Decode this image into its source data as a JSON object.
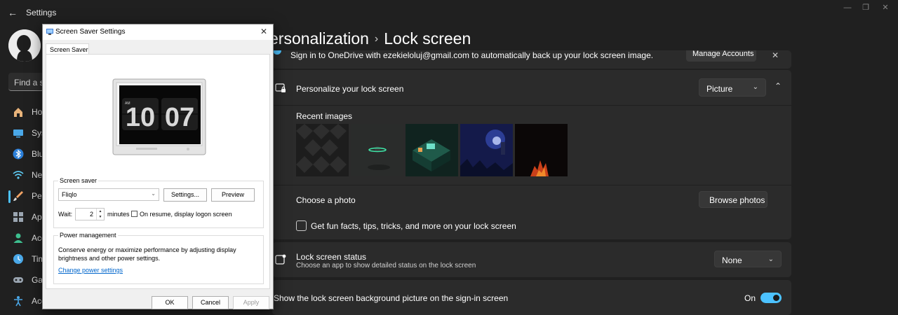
{
  "app": {
    "title": "Settings"
  },
  "sidebar": {
    "search_placeholder": "Find a se",
    "items": [
      {
        "label": "Ho",
        "icon": "home-icon"
      },
      {
        "label": "Sys",
        "icon": "system-icon"
      },
      {
        "label": "Blu",
        "icon": "bluetooth-icon"
      },
      {
        "label": "Net",
        "icon": "network-icon"
      },
      {
        "label": "Per",
        "icon": "personalization-icon"
      },
      {
        "label": "App",
        "icon": "apps-icon"
      },
      {
        "label": "Acc",
        "icon": "accounts-icon"
      },
      {
        "label": "Tim",
        "icon": "time-icon"
      },
      {
        "label": "Gar",
        "icon": "gaming-icon"
      },
      {
        "label": "Acc",
        "icon": "accessibility-icon"
      }
    ]
  },
  "header": {
    "breadcrumb_parent": "ersonalization",
    "breadcrumb_sep": "›",
    "title": "Lock screen"
  },
  "onedrive": {
    "text": "Sign in to OneDrive with ezekieloluj@gmail.com to automatically back up your lock screen image.",
    "manage_label": "Manage Accounts",
    "close": "✕"
  },
  "personalize": {
    "title": "Personalize your lock screen",
    "dropdown_value": "Picture",
    "recent_images_label": "Recent images",
    "choose_photo_label": "Choose a photo",
    "browse_label": "Browse photos",
    "fun_facts_label": "Get fun facts, tips, tricks, and more on your lock screen"
  },
  "status": {
    "title": "Lock screen status",
    "subtitle": "Choose an app to show detailed status on the lock screen",
    "dropdown_value": "None"
  },
  "signin": {
    "label": "Show the lock screen background picture on the sign-in screen",
    "toggle_label": "On",
    "toggle_on": true
  },
  "dialog": {
    "title": "Screen Saver Settings",
    "tab_label": "Screen Saver",
    "clock_hour": "10",
    "clock_minute": "07",
    "clock_am": "AM",
    "screensaver_group": "Screen saver",
    "selected_saver": "Fliqlo",
    "settings_label": "Settings...",
    "preview_label": "Preview",
    "wait_label": "Wait:",
    "wait_value": "2",
    "minutes_label": "minutes",
    "resume_label": "On resume, display logon screen",
    "power_group": "Power management",
    "power_text": "Conserve energy or maximize performance by adjusting display brightness and other power settings.",
    "power_link": "Change power settings",
    "ok_label": "OK",
    "cancel_label": "Cancel",
    "apply_label": "Apply"
  },
  "colors": {
    "accent": "#4cc2ff",
    "card": "#2b2b2b",
    "background": "#202020"
  }
}
